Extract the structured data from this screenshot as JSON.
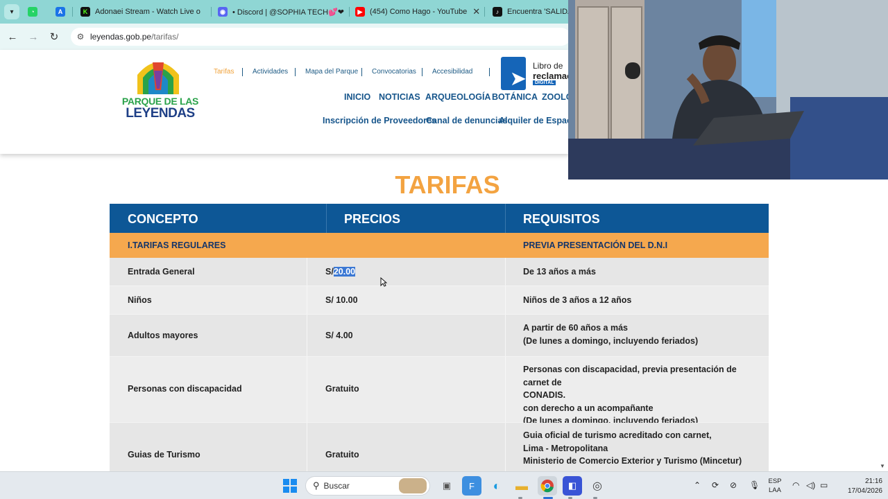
{
  "browser": {
    "tabs": [
      {
        "title": "Adonaei Stream - Watch Live o",
        "icon": "kick-icon",
        "color": "#53fc18"
      },
      {
        "title": "• Discord | @SOPHIA TECH💕❤",
        "icon": "discord-icon",
        "color": "#5865f2"
      },
      {
        "title": "(454) Como Hago - YouTube",
        "icon": "youtube-icon",
        "color": "#ff0000"
      },
      {
        "title": "Encuentra 'SALIDA P",
        "icon": "tiktok-icon",
        "color": "#111111"
      }
    ],
    "url_host": "leyendas.gob.pe",
    "url_path": "/tarifas/"
  },
  "site": {
    "logo_line1": "PARQUE DE LAS",
    "logo_line2": "LEYENDAS",
    "top_nav": [
      "Tarifas",
      "Actividades",
      "Mapa del Parque",
      "Convocatorias",
      "Accesibilidad"
    ],
    "main_nav": [
      "INICIO",
      "NOTICIAS",
      "ARQUEOLOGÍA",
      "BOTÁNICA",
      "ZOOLO"
    ],
    "sub_nav": [
      "Inscripción de Proveedores",
      "Canal de denuncias",
      "Alquiler de Espacios"
    ],
    "libro": {
      "line1": "Libro de",
      "line2": "reclamac",
      "line3": "DIGITAL"
    }
  },
  "page": {
    "title": "TARIFAS",
    "table": {
      "headers": [
        "CONCEPTO",
        "PRECIOS",
        "REQUISITOS"
      ],
      "section": {
        "concept": "I.TARIFAS REGULARES",
        "requirements": "PREVIA PRESENTACIÓN DEL D.N.I"
      },
      "rows": [
        {
          "concept": "Entrada General",
          "price_prefix": "S/",
          "price_value": "20.00",
          "requirements": [
            "De 13 años a más"
          ]
        },
        {
          "concept": "Niños",
          "price": "S/ 10.00",
          "requirements": [
            "Niños de 3 años a 12 años"
          ]
        },
        {
          "concept": "Adultos mayores",
          "price": "S/ 4.00",
          "requirements": [
            "A partir de 60 años a más",
            "(De lunes a domingo, incluyendo feriados)"
          ]
        },
        {
          "concept": "Personas con discapacidad",
          "price": "Gratuito",
          "requirements": [
            "Personas con discapacidad, previa presentación de carnet de",
            "CONADIS.",
            "con derecho a un acompañante",
            "(De lunes a domingo, incluyendo feriados)"
          ]
        },
        {
          "concept": "Guias de Turismo",
          "price": "Gratuito",
          "requirements": [
            "Guia oficial de turismo acreditado con carnet,",
            "Lima - Metropolitana",
            "Ministerio de Comercio Exterior y Turismo (Mincetur)"
          ]
        }
      ]
    }
  },
  "taskbar": {
    "search_label": "Buscar",
    "lang_line1": "ESP",
    "lang_line2": "LAA",
    "time": "21:16",
    "date": "17/04/2026"
  }
}
